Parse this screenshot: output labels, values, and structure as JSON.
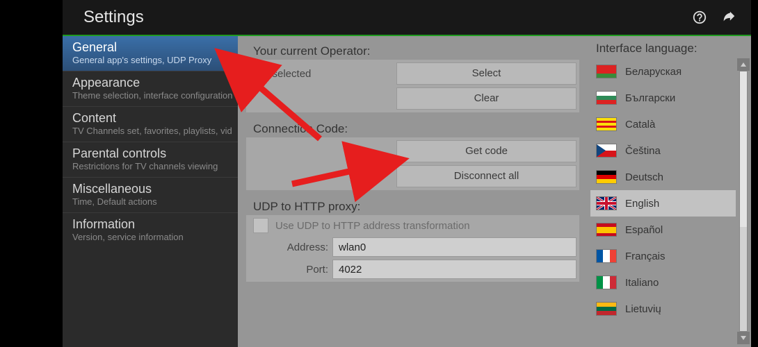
{
  "header": {
    "title": "Settings"
  },
  "sidebar": {
    "items": [
      {
        "title": "General",
        "subtitle": "General app's settings, UDP Proxy"
      },
      {
        "title": "Appearance",
        "subtitle": "Theme selection, interface configuration"
      },
      {
        "title": "Content",
        "subtitle": "TV Channels set, favorites, playlists, vid"
      },
      {
        "title": "Parental controls",
        "subtitle": "Restrictions for TV channels viewing"
      },
      {
        "title": "Miscellaneous",
        "subtitle": "Time, Default actions"
      },
      {
        "title": "Information",
        "subtitle": "Version, service information"
      }
    ],
    "selected": 0
  },
  "operator": {
    "section_label": "Your current Operator:",
    "value": "Not selected",
    "select_label": "Select",
    "clear_label": "Clear"
  },
  "connection": {
    "section_label": "Connection Code:",
    "get_label": "Get code",
    "disconnect_label": "Disconnect all"
  },
  "udp": {
    "section_label": "UDP to HTTP proxy:",
    "check_label": "Use UDP to HTTP address transformation",
    "address_label": "Address:",
    "address_value": "wlan0",
    "port_label": "Port:",
    "port_value": "4022"
  },
  "language": {
    "section_label": "Interface language:",
    "items": [
      {
        "name": "Беларуская",
        "flag": "belarus"
      },
      {
        "name": "Български",
        "flag": "bulgaria"
      },
      {
        "name": "Català",
        "flag": "catalonia"
      },
      {
        "name": "Čeština",
        "flag": "czech"
      },
      {
        "name": "Deutsch",
        "flag": "germany"
      },
      {
        "name": "English",
        "flag": "uk"
      },
      {
        "name": "Español",
        "flag": "spain"
      },
      {
        "name": "Français",
        "flag": "france"
      },
      {
        "name": "Italiano",
        "flag": "italy"
      },
      {
        "name": "Lietuvių",
        "flag": "lithuania"
      }
    ],
    "selected": 5
  }
}
